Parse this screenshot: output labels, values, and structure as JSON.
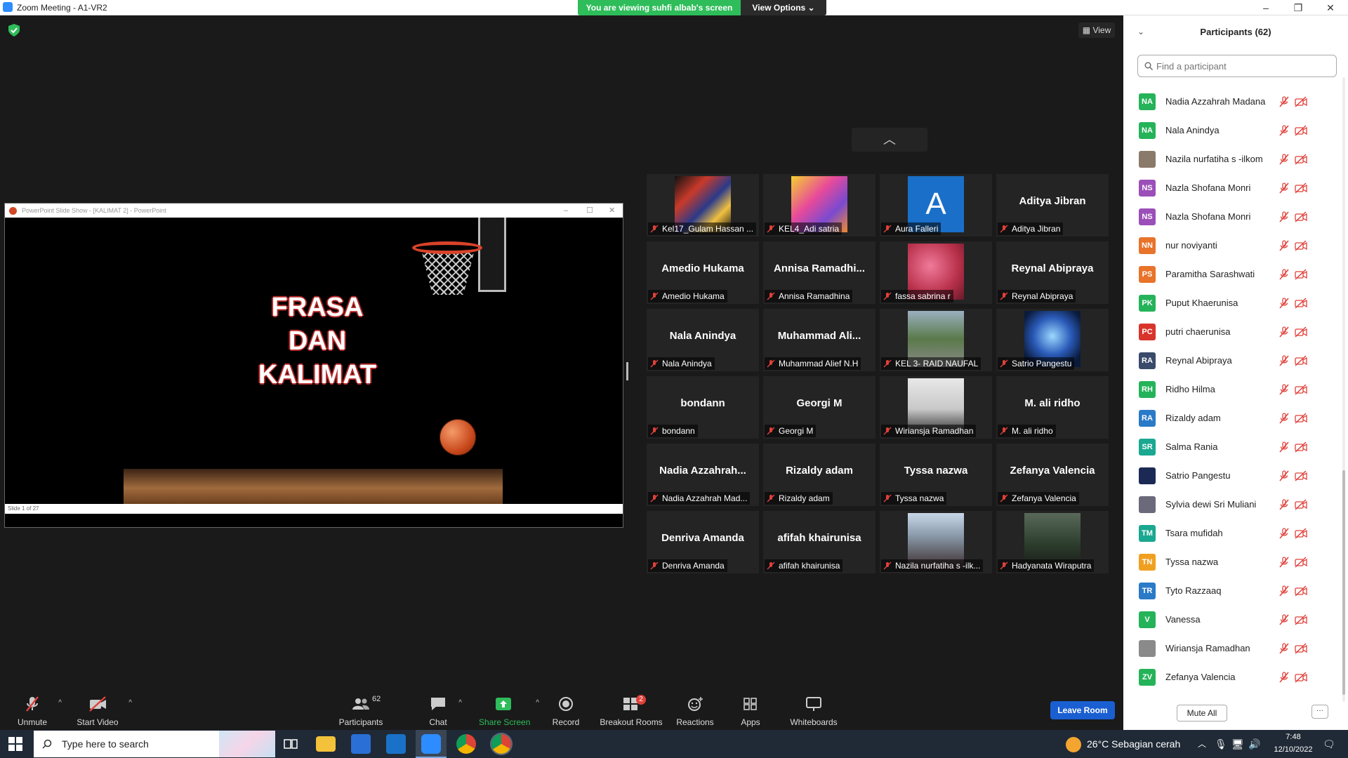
{
  "window": {
    "title": "Zoom Meeting - A1-VR2",
    "minimize": "–",
    "maximize": "❐",
    "close": "✕"
  },
  "banner": {
    "viewing": "You are viewing suhfi albab's screen",
    "view_options": "View Options ⌄"
  },
  "meeting": {
    "view_button": "View"
  },
  "ppt": {
    "title": "PowerPoint Slide Show - [KALIMAT 2] - PowerPoint",
    "slide_title": "FRASA\nDAN\nKALIMAT",
    "status": "Slide 1 of 27"
  },
  "grid_tiles": [
    {
      "display": "",
      "label": "Kel17_Gulam Hassan ...",
      "thumb": "city"
    },
    {
      "display": "",
      "label": "KEL4_Adi satria",
      "thumb": "swirl"
    },
    {
      "display": "",
      "label": "Aura Falleri",
      "thumb": "letter-a"
    },
    {
      "display": "Aditya Jibran",
      "label": "Aditya Jibran",
      "thumb": ""
    },
    {
      "display": "Amedio Hukama",
      "label": "Amedio Hukama",
      "thumb": ""
    },
    {
      "display": "Annisa  Ramadhi...",
      "label": "Annisa Ramadhina",
      "thumb": ""
    },
    {
      "display": "",
      "label": "fassa sabrina r",
      "thumb": "flowers"
    },
    {
      "display": "Reynal Abipraya",
      "label": "Reynal Abipraya",
      "thumb": ""
    },
    {
      "display": "Nala Anindya",
      "label": "Nala Anindya",
      "thumb": ""
    },
    {
      "display": "Muhammad  Ali...",
      "label": "Muhammad Alief N.H",
      "thumb": ""
    },
    {
      "display": "",
      "label": "KEL 3- RAID NAUFAL",
      "thumb": "road"
    },
    {
      "display": "",
      "label": "Satrio Pangestu",
      "thumb": "neon"
    },
    {
      "display": "bondann",
      "label": "bondann",
      "thumb": ""
    },
    {
      "display": "Georgi M",
      "label": "Georgi M",
      "thumb": ""
    },
    {
      "display": "",
      "label": "Wiriansja Ramadhan",
      "thumb": "person"
    },
    {
      "display": "M. ali ridho",
      "label": "M. ali ridho",
      "thumb": ""
    },
    {
      "display": "Nadia  Azzahrah...",
      "label": "Nadia Azzahrah Mad...",
      "thumb": ""
    },
    {
      "display": "Rizaldy adam",
      "label": "Rizaldy adam",
      "thumb": ""
    },
    {
      "display": "Tyssa nazwa",
      "label": "Tyssa nazwa",
      "thumb": ""
    },
    {
      "display": "Zefanya Valencia",
      "label": "Zefanya Valencia",
      "thumb": ""
    },
    {
      "display": "Denriva Amanda",
      "label": "Denriva Amanda",
      "thumb": ""
    },
    {
      "display": "afifah khairunisa",
      "label": "afifah khairunisa",
      "thumb": ""
    },
    {
      "display": "",
      "label": "Nazila nurfatiha s -ilk...",
      "thumb": "group"
    },
    {
      "display": "",
      "label": "Hadyanata Wiraputra",
      "thumb": "forest"
    }
  ],
  "toolbar": {
    "unmute": "Unmute",
    "start_video": "Start Video",
    "participants": "Participants",
    "participants_count": "62",
    "chat": "Chat",
    "share_screen": "Share Screen",
    "record": "Record",
    "breakout_rooms": "Breakout Rooms",
    "breakout_badge": "2",
    "reactions": "Reactions",
    "apps": "Apps",
    "whiteboards": "Whiteboards",
    "leave": "Leave Room",
    "caret": "^"
  },
  "panel": {
    "title": "Participants (62)",
    "search_placeholder": "Find a participant",
    "mute_all": "Mute All",
    "more": "···",
    "participants": [
      {
        "initials": "NA",
        "name": "Nadia Azzahrah Madana",
        "color": "#25b35a"
      },
      {
        "initials": "NA",
        "name": "Nala Anindya",
        "color": "#25b35a"
      },
      {
        "initials": "",
        "name": "Nazila nurfatiha s -ilkom",
        "color": "#8a7a6a"
      },
      {
        "initials": "NS",
        "name": "Nazla Shofana Monri",
        "color": "#9b4fb8"
      },
      {
        "initials": "NS",
        "name": "Nazla Shofana Monri",
        "color": "#9b4fb8"
      },
      {
        "initials": "NN",
        "name": "nur noviyanti",
        "color": "#e8732a"
      },
      {
        "initials": "PS",
        "name": "Paramitha Sarashwati",
        "color": "#e8732a"
      },
      {
        "initials": "PK",
        "name": "Puput Khaerunisa",
        "color": "#25b35a"
      },
      {
        "initials": "PC",
        "name": "putri chaerunisa",
        "color": "#d9342b"
      },
      {
        "initials": "RA",
        "name": "Reynal Abipraya",
        "color": "#3a4a6a"
      },
      {
        "initials": "RH",
        "name": "Ridho Hilma",
        "color": "#25b35a"
      },
      {
        "initials": "RA",
        "name": "Rizaldy adam",
        "color": "#2a7ac8"
      },
      {
        "initials": "SR",
        "name": "Salma Rania",
        "color": "#1aa890"
      },
      {
        "initials": "",
        "name": "Satrio Pangestu",
        "color": "#1b2a55"
      },
      {
        "initials": "",
        "name": "Sylvia dewi Sri Muliani",
        "color": "#6a6a7a"
      },
      {
        "initials": "TM",
        "name": "Tsara mufidah",
        "color": "#1aa890"
      },
      {
        "initials": "TN",
        "name": "Tyssa nazwa",
        "color": "#f0a020"
      },
      {
        "initials": "TR",
        "name": "Tyto Razzaaq",
        "color": "#2a7ac8"
      },
      {
        "initials": "V",
        "name": "Vanessa",
        "color": "#25b35a"
      },
      {
        "initials": "",
        "name": "Wiriansja Ramadhan",
        "color": "#8a8a8a"
      },
      {
        "initials": "ZV",
        "name": "Zefanya Valencia",
        "color": "#25b35a"
      }
    ]
  },
  "taskbar": {
    "search": "Type here to search",
    "weather": "26°C  Sebagian cerah",
    "time": "7:48",
    "date": "12/10/2022"
  }
}
